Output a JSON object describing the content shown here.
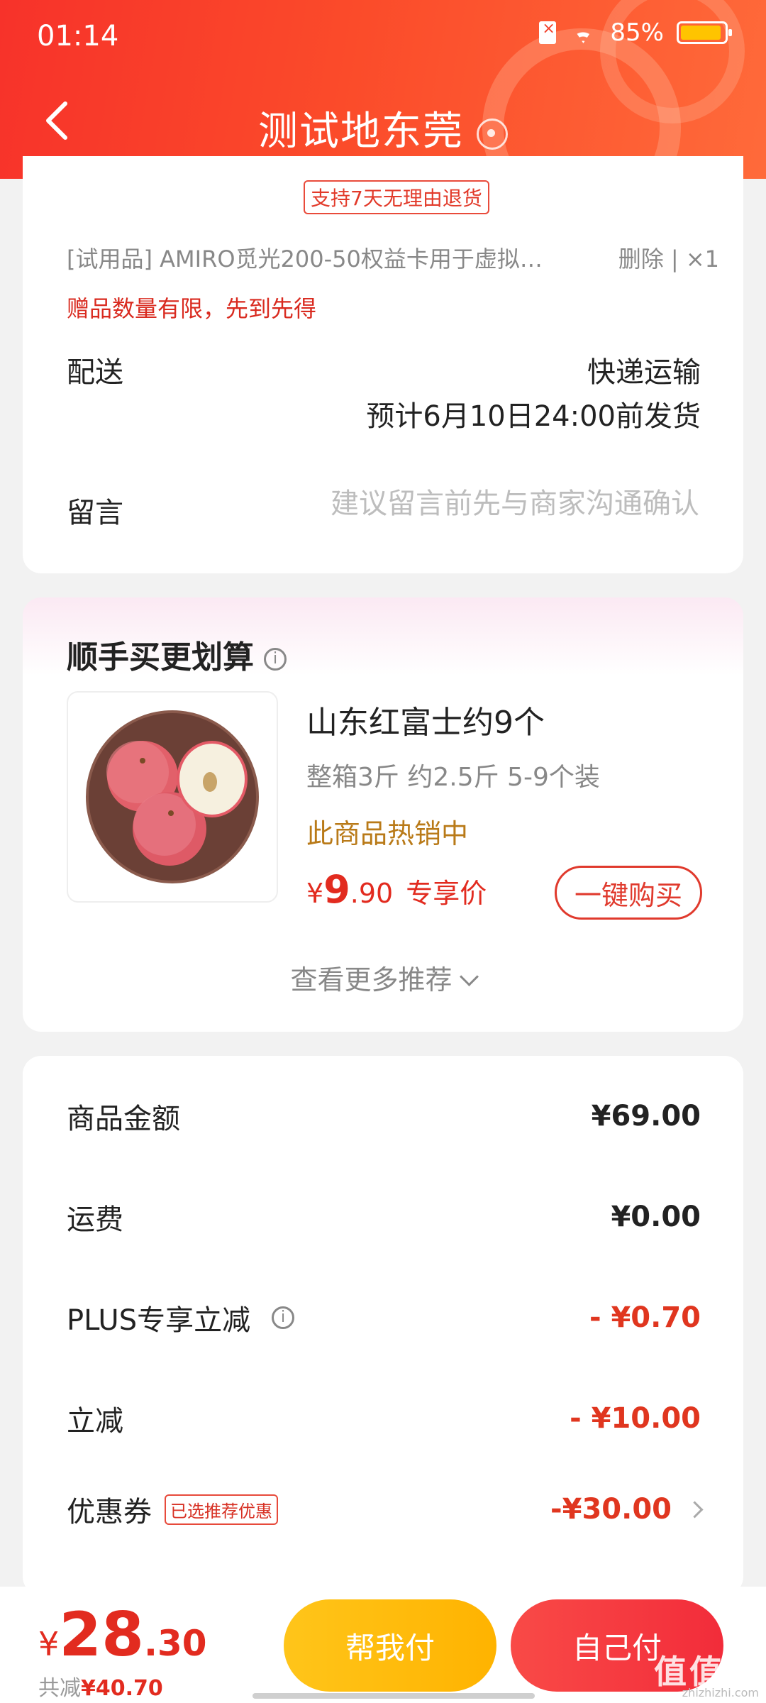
{
  "status_bar": {
    "time": "01:14",
    "battery": "85%"
  },
  "header": {
    "title": "测试地东莞"
  },
  "order_card": {
    "return_policy": "支持7天无理由退货",
    "trial_item": "[试用品]   AMIRO觅光200-50权益卡用于虚拟…",
    "trial_actions": "删除  |  ×1",
    "limit_note": "赠品数量有限，先到先得",
    "shipping_label": "配送",
    "shipping_method": "快递运输",
    "shipping_eta": "预计6月10日24:00前发货",
    "message_label": "留言",
    "message_placeholder": "建议留言前先与商家沟通确认"
  },
  "recommend": {
    "title": "顺手买更划算",
    "product": {
      "name": "山东红富士约9个",
      "spec": "整箱3斤 约2.5斤 5-9个装",
      "hot": "此商品热销中",
      "price_currency": "¥",
      "price_int": "9",
      "price_dec": ".90",
      "price_tag": "专享价",
      "buy_label": "一键购买"
    },
    "more_label": "查看更多推荐"
  },
  "fees": [
    {
      "label": "商品金额",
      "value": "¥69.00"
    },
    {
      "label": "运费",
      "value": "¥0.00"
    },
    {
      "label": "PLUS专享立减",
      "value": "- ¥0.70"
    },
    {
      "label": "立减",
      "value": "- ¥10.00"
    },
    {
      "label": "优惠券",
      "badge": "已选推荐优惠",
      "value": "-¥30.00"
    }
  ],
  "bottom": {
    "currency": "¥",
    "total_int": "28",
    "total_dec": ".30",
    "saved_label": "共减",
    "saved_value": "¥40.70",
    "help_pay": "帮我付",
    "self_pay": "自己付"
  },
  "watermark": {
    "main": "值值值",
    "sub": "zhizhizhi.com"
  },
  "colors": {
    "accent": "#f2352b",
    "price_red": "#e22b1f",
    "gold": "#ffb300"
  }
}
